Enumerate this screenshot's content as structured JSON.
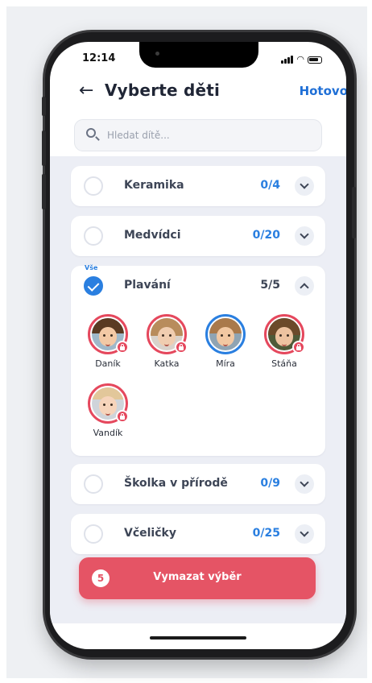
{
  "status_bar": {
    "time": "12:14"
  },
  "header": {
    "title": "Vyberte děti",
    "done_label": "Hotovo"
  },
  "search": {
    "placeholder": "Hledat dítě..."
  },
  "groups": [
    {
      "name": "Keramika",
      "count": "0/4",
      "selected": false,
      "expanded": false
    },
    {
      "name": "Medvídci",
      "count": "0/20",
      "selected": false,
      "expanded": false
    },
    {
      "name": "Plavání",
      "count": "5/5",
      "selected": true,
      "expanded": true,
      "select_all_label": "Vše",
      "children": [
        {
          "name": "Daník",
          "locked": true
        },
        {
          "name": "Katka",
          "locked": true
        },
        {
          "name": "Míra",
          "locked": false
        },
        {
          "name": "Stáňa",
          "locked": true
        },
        {
          "name": "Vandík",
          "locked": true
        }
      ]
    },
    {
      "name": "Školka v přírodě",
      "count": "0/9",
      "selected": false,
      "expanded": false
    },
    {
      "name": "Včeličky",
      "count": "0/25",
      "selected": false,
      "expanded": false
    }
  ],
  "clear_button": {
    "count": "5",
    "label": "Vymazat výběr"
  },
  "colors": {
    "accent_blue": "#2a7fe0",
    "accent_red": "#e55465",
    "text_dark": "#3d4556"
  }
}
